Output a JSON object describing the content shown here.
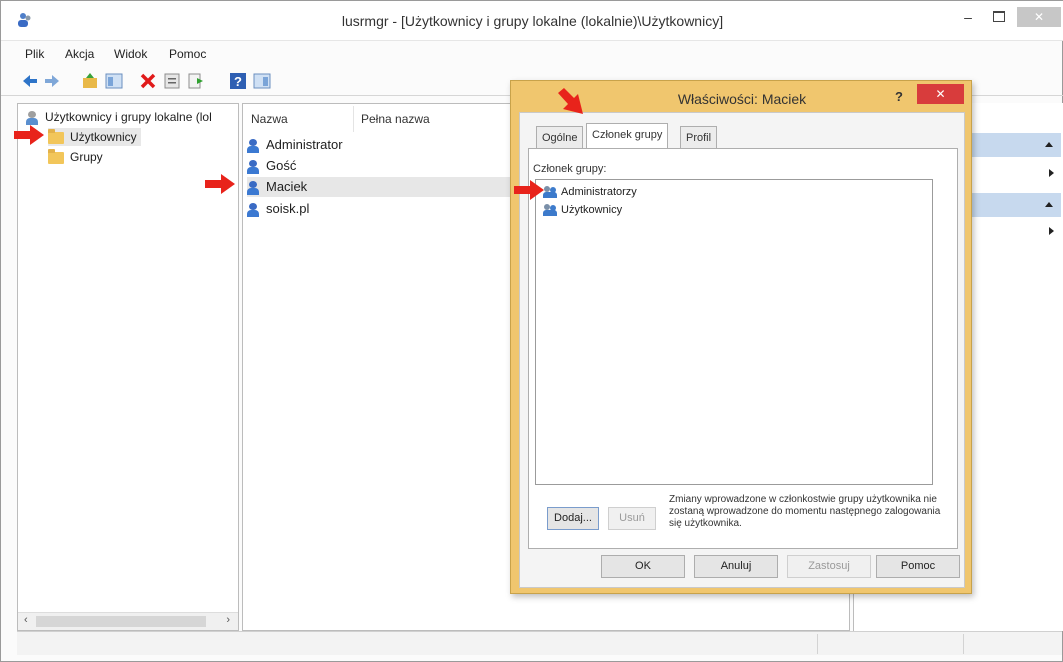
{
  "window": {
    "title": "lusrmgr - [Użytkownicy i grupy lokalne (lokalnie)\\Użytkownicy]",
    "minimize_glyph": "–",
    "close_glyph": "✕"
  },
  "menu": [
    "Plik",
    "Akcja",
    "Widok",
    "Pomoc"
  ],
  "toolbar_icons": [
    "back-arrow-icon",
    "forward-arrow-icon",
    "up-folder-icon",
    "show-hide-tree-icon",
    "delete-icon",
    "properties-icon",
    "export-list-icon",
    "help-icon",
    "show-hide-action-pane-icon"
  ],
  "tree": {
    "root_label": "Użytkownicy i grupy lokalne (lol",
    "items": [
      "Użytkownicy",
      "Grupy"
    ]
  },
  "list": {
    "columns": [
      "Nazwa",
      "Pełna nazwa"
    ],
    "rows": [
      "Administrator",
      "Gość",
      "Maciek",
      "soisk.pl"
    ]
  },
  "dialog": {
    "title": "Właściwości: Maciek",
    "help_glyph": "?",
    "close_glyph": "✕",
    "tabs": [
      "Ogólne",
      "Członek grupy",
      "Profil"
    ],
    "member_label": "Członek grupy:",
    "members": [
      "Administratorzy",
      "Użytkownicy"
    ],
    "add_button": "Dodaj...",
    "remove_button": "Usuń",
    "info_text": "Zmiany wprowadzone w członkostwie grupy użytkownika nie zostaną wprowadzone do momentu następnego zalogowania się użytkownika.",
    "ok_button": "OK",
    "cancel_button": "Anuluj",
    "apply_button": "Zastosuj",
    "help_button": "Pomoc"
  },
  "colors": {
    "dialog_frame": "#f0c66e",
    "close_red": "#d83c3c",
    "arrow_red": "#e8231b",
    "action_header": "#c7d9ee"
  }
}
